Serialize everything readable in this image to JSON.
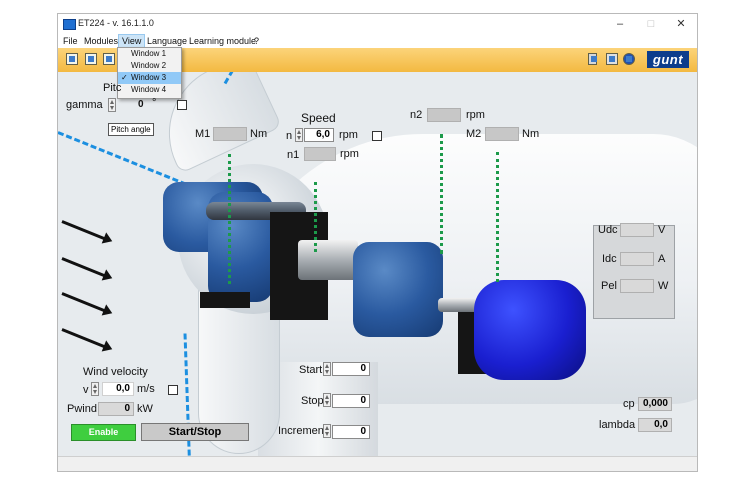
{
  "window": {
    "title": "ET224 - v. 16.1.1.0",
    "minimize_icon": "–",
    "maximize_icon": "□",
    "close_icon": "✕"
  },
  "menubar": {
    "items": [
      "File",
      "Modules",
      "View",
      "Language",
      "Learning module",
      "?"
    ]
  },
  "view_menu": {
    "items": [
      "Window 1",
      "Window 2",
      "Window 3",
      "Window 4"
    ],
    "selected": "Window 3",
    "check_mark": "✓"
  },
  "toolbar": {
    "logo_text": "gunt"
  },
  "pitch": {
    "title": "Pitc",
    "label": "gamma",
    "value": "0",
    "unit": "°",
    "tooltip": "Pitch angle"
  },
  "torque1": {
    "label": "M1",
    "value": "",
    "unit": "Nm"
  },
  "speed": {
    "title": "Speed",
    "n_label": "n",
    "n_value": "6,0",
    "n_unit": "rpm",
    "n1_label": "n1",
    "n1_value": "",
    "n1_unit": "rpm",
    "n2_label": "n2",
    "n2_value": "",
    "n2_unit": "rpm"
  },
  "torque2": {
    "label": "M2",
    "value": "",
    "unit": "Nm"
  },
  "electrical": {
    "udc_label": "Udc",
    "udc_unit": "V",
    "idc_label": "Idc",
    "idc_unit": "A",
    "pel_label": "Pel",
    "pel_unit": "W"
  },
  "wind": {
    "title": "Wind velocity",
    "v_label": "v",
    "v_value": "0,0",
    "v_unit": "m/s",
    "pwind_label": "Pwind",
    "pwind_value": "0",
    "pwind_unit": "kW"
  },
  "sweep": {
    "start_label": "Start",
    "start_value": "0",
    "stop_label": "Stop",
    "stop_value": "0",
    "increment_label": "Increment",
    "increment_value": "0"
  },
  "results": {
    "cp_label": "cp",
    "cp_value": "0,000",
    "lambda_label": "lambda",
    "lambda_value": "0,0"
  },
  "buttons": {
    "enable": "Enable",
    "start_stop": "Start/Stop"
  },
  "colors": {
    "toolbar": "#f3b941",
    "enable_button": "#3fce3f",
    "guide_line": "#1c8fe0",
    "sensor_line": "#1c9a4a",
    "generator": "#1a1fd0"
  }
}
